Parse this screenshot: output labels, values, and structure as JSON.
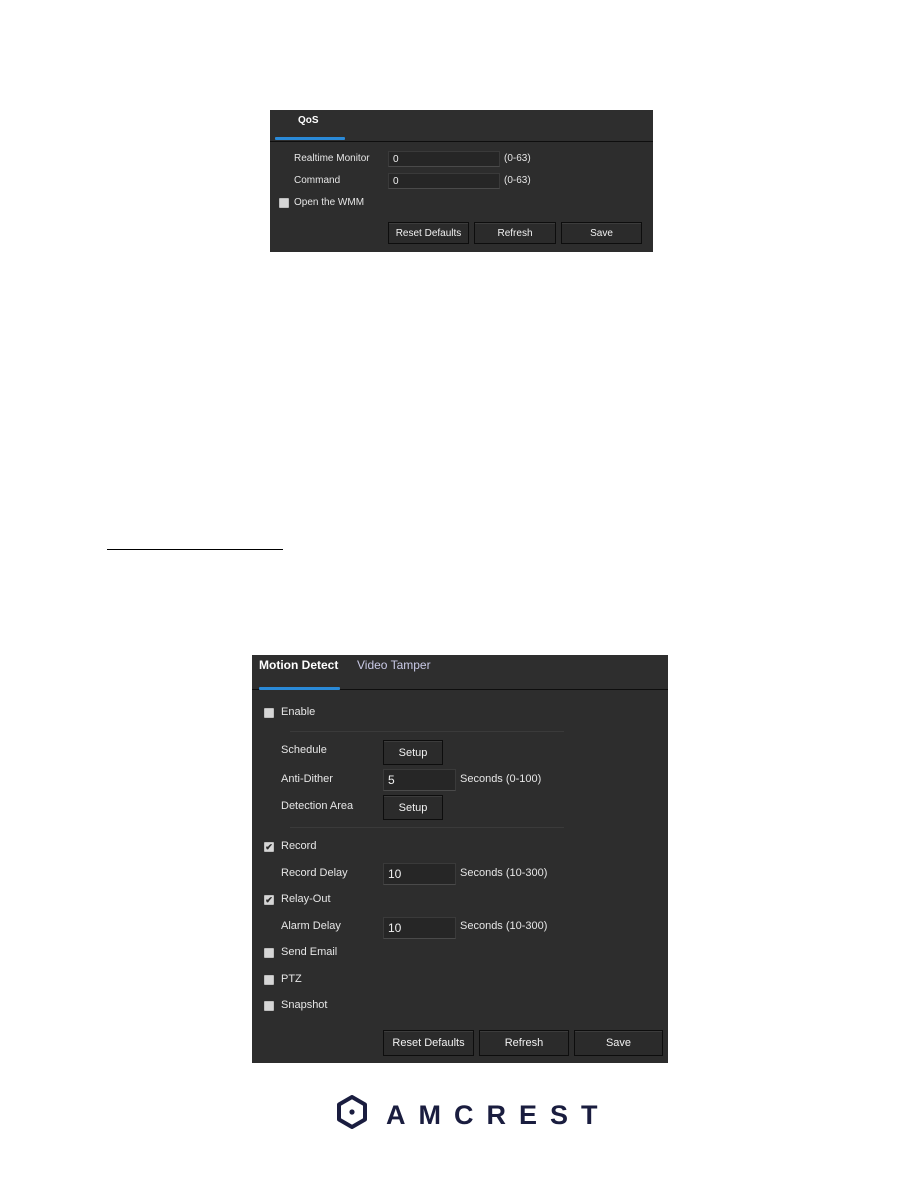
{
  "qos_panel": {
    "tabs": [
      {
        "label": "QoS",
        "active": true
      }
    ],
    "fields": [
      {
        "label": "Realtime Monitor",
        "value": "0",
        "hint": "(0-63)"
      },
      {
        "label": "Command",
        "value": "0",
        "hint": "(0-63)"
      }
    ],
    "wmm": {
      "label": "Open the WMM",
      "checked": false
    },
    "buttons": {
      "reset": "Reset Defaults",
      "refresh": "Refresh",
      "save": "Save"
    }
  },
  "motion_panel": {
    "tabs": [
      {
        "label": "Motion Detect",
        "active": true
      },
      {
        "label": "Video Tamper",
        "active": false
      }
    ],
    "enable": {
      "label": "Enable",
      "checked": false
    },
    "schedule": {
      "label": "Schedule",
      "button": "Setup"
    },
    "anti_dither": {
      "label": "Anti-Dither",
      "value": "5",
      "hint": "Seconds (0-100)"
    },
    "detection_area": {
      "label": "Detection Area",
      "button": "Setup"
    },
    "record": {
      "label": "Record",
      "checked": true
    },
    "record_delay": {
      "label": "Record Delay",
      "value": "10",
      "hint": "Seconds (10-300)"
    },
    "relay_out": {
      "label": "Relay-Out",
      "checked": true
    },
    "alarm_delay": {
      "label": "Alarm Delay",
      "value": "10",
      "hint": "Seconds (10-300)"
    },
    "send_email": {
      "label": "Send Email",
      "checked": false
    },
    "ptz": {
      "label": "PTZ",
      "checked": false
    },
    "snapshot": {
      "label": "Snapshot",
      "checked": false
    },
    "buttons": {
      "reset": "Reset Defaults",
      "refresh": "Refresh",
      "save": "Save"
    }
  },
  "brand": {
    "name": "AMCREST",
    "color": "#1a1d3f",
    "accent": "#2a8ad8"
  },
  "checkmark": "✔"
}
